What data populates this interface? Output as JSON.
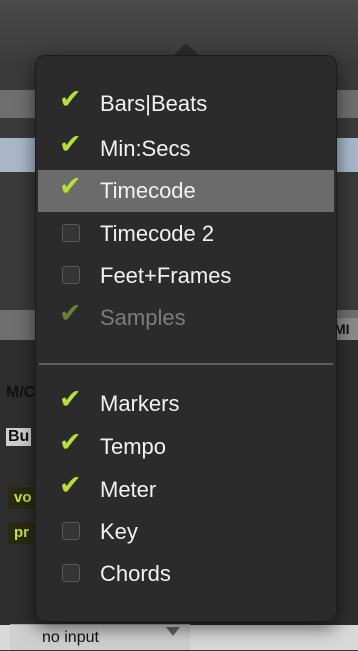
{
  "menu": {
    "groups": [
      {
        "items": [
          {
            "label": "Bars|Beats",
            "checked": true,
            "highlighted": false,
            "disabled": false
          },
          {
            "label": "Min:Secs",
            "checked": true,
            "highlighted": false,
            "disabled": false
          },
          {
            "label": "Timecode",
            "checked": true,
            "highlighted": true,
            "disabled": false
          },
          {
            "label": "Timecode 2",
            "checked": false,
            "highlighted": false,
            "disabled": false
          },
          {
            "label": "Feet+Frames",
            "checked": false,
            "highlighted": false,
            "disabled": false
          },
          {
            "label": "Samples",
            "checked": true,
            "highlighted": false,
            "disabled": true
          }
        ]
      },
      {
        "items": [
          {
            "label": "Markers",
            "checked": true,
            "highlighted": false,
            "disabled": false
          },
          {
            "label": "Tempo",
            "checked": true,
            "highlighted": false,
            "disabled": false
          },
          {
            "label": "Meter",
            "checked": true,
            "highlighted": false,
            "disabled": false
          },
          {
            "label": "Key",
            "checked": false,
            "highlighted": false,
            "disabled": false
          },
          {
            "label": "Chords",
            "checked": false,
            "highlighted": false,
            "disabled": false
          }
        ]
      }
    ]
  },
  "background": {
    "input_selector": "no input",
    "left_fragment_1": "M/C",
    "left_fragment_2": "Bu",
    "green_fragment_1": "vo",
    "green_fragment_2": "pr",
    "right_fragment": "MI"
  },
  "colors": {
    "check_mark": "#b9de3a",
    "menu_background": "#2b2b2b",
    "highlight": "#6b6b6b"
  },
  "icons": {
    "check": "check-icon",
    "dropdown": "triangle-down-icon"
  }
}
